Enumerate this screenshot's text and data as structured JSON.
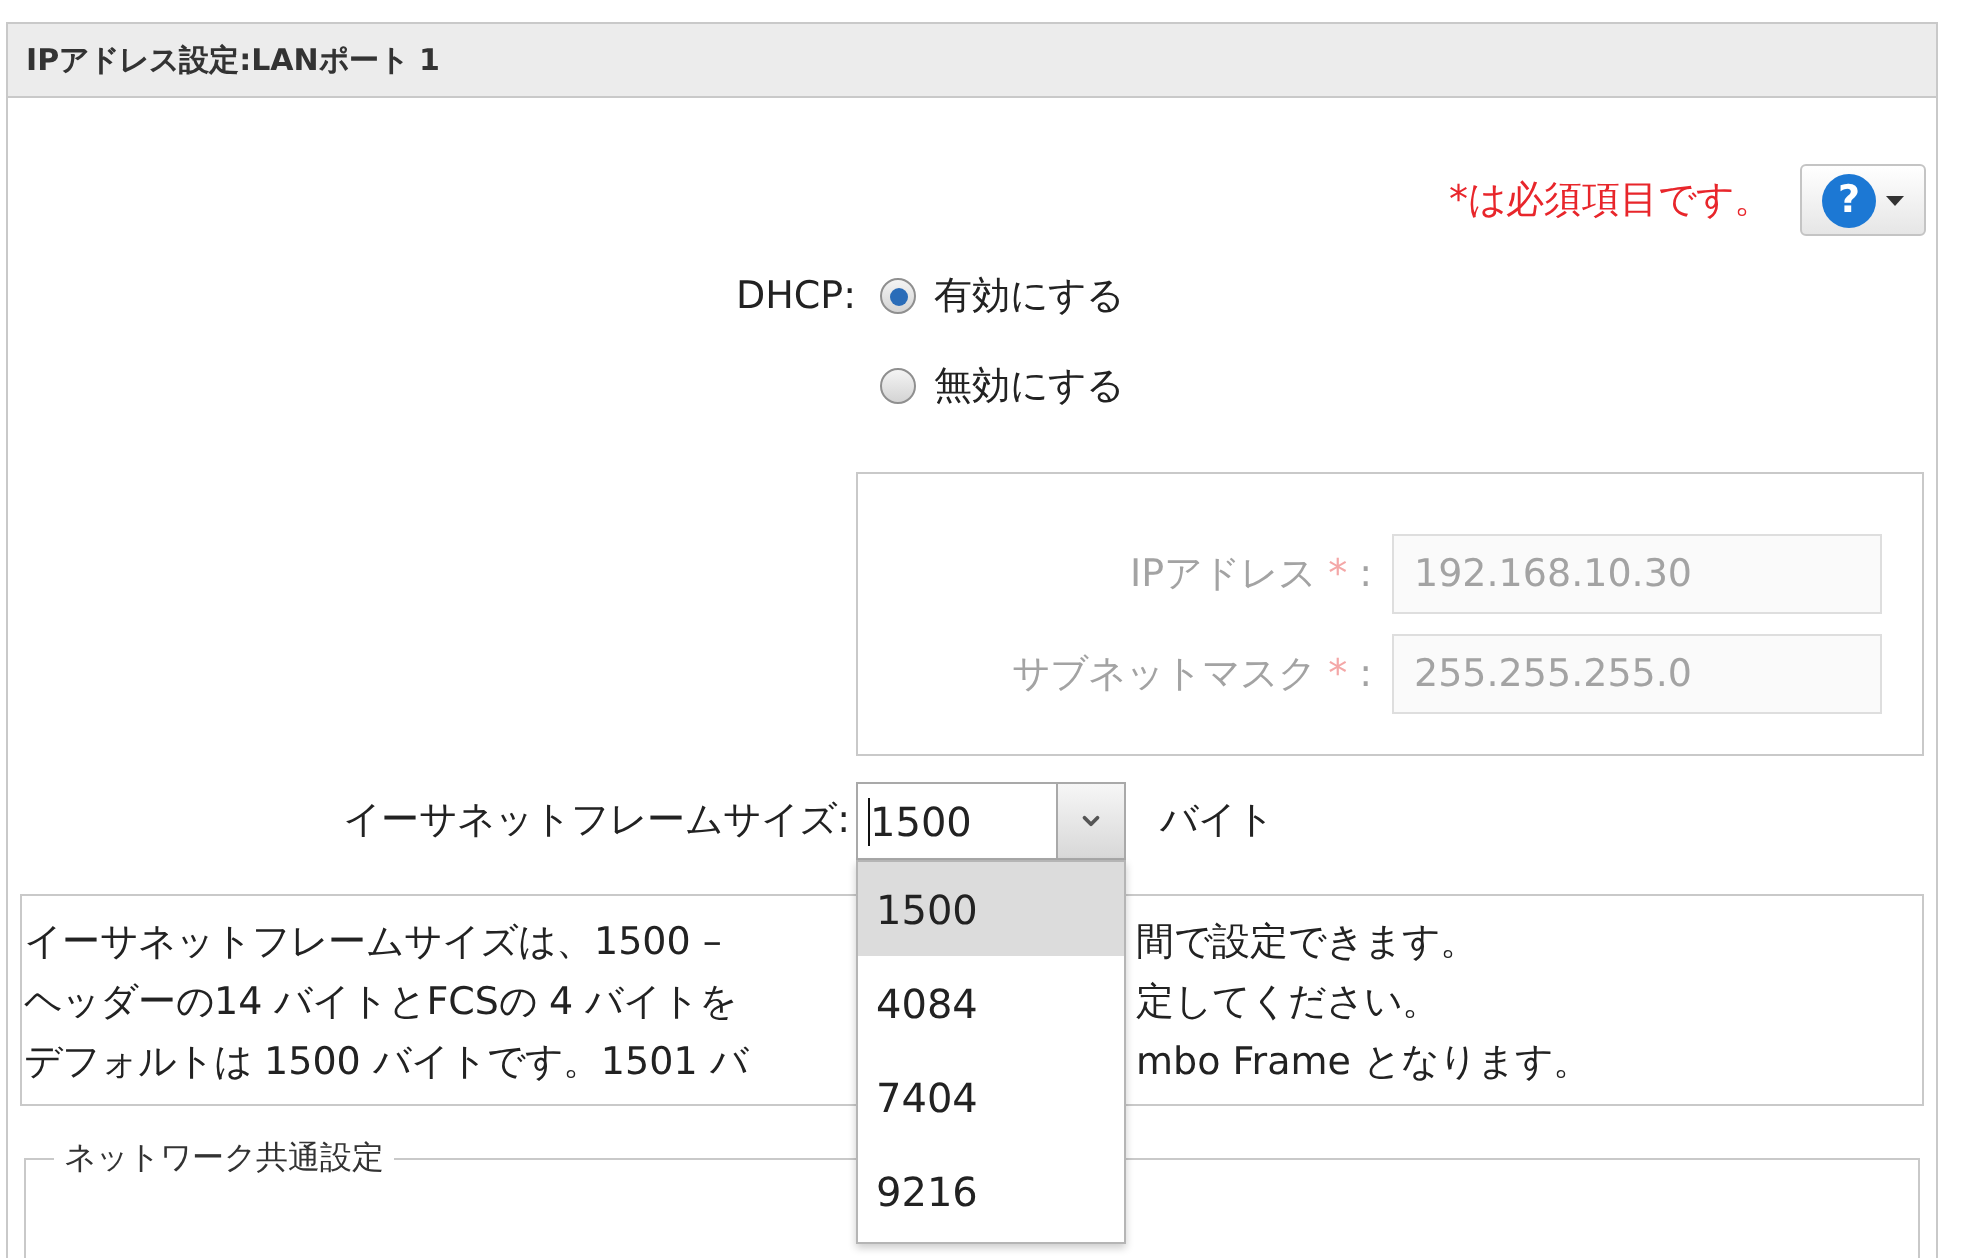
{
  "panel": {
    "title": "IPアドレス設定:LANポート 1"
  },
  "required_note": "*は必須項目です。",
  "help_button": {
    "icon_text": "?"
  },
  "dhcp": {
    "label": "DHCP:",
    "options": [
      {
        "label": "有効にする",
        "selected": true
      },
      {
        "label": "無効にする",
        "selected": false
      }
    ]
  },
  "static_ip": {
    "disabled": true,
    "fields": [
      {
        "label": "IPアドレス",
        "mark": "*",
        "separator": ":",
        "value": "192.168.10.30"
      },
      {
        "label": "サブネットマスク",
        "mark": "*",
        "separator": ":",
        "value": "255.255.255.0"
      }
    ]
  },
  "frame_size": {
    "label": "イーサネットフレームサイズ:",
    "value": "1500",
    "focused": true,
    "unit": "バイト",
    "expanded": true,
    "options": [
      {
        "label": "1500",
        "selected": true
      },
      {
        "label": "4084",
        "selected": false
      },
      {
        "label": "7404",
        "selected": false
      },
      {
        "label": "9216",
        "selected": false
      }
    ]
  },
  "description": {
    "lines": [
      {
        "start": "イーサネットフレームサイズは、1500 –",
        "end": "間で設定できます。"
      },
      {
        "start": "ヘッダーの14 バイトとFCSの 4 バイトを",
        "end": "定してください。"
      },
      {
        "start": "デフォルトは 1500 バイトです。1501 バ",
        "end": "mbo Frame となります。"
      }
    ]
  },
  "network_common": {
    "legend": "ネットワーク共通設定"
  }
}
